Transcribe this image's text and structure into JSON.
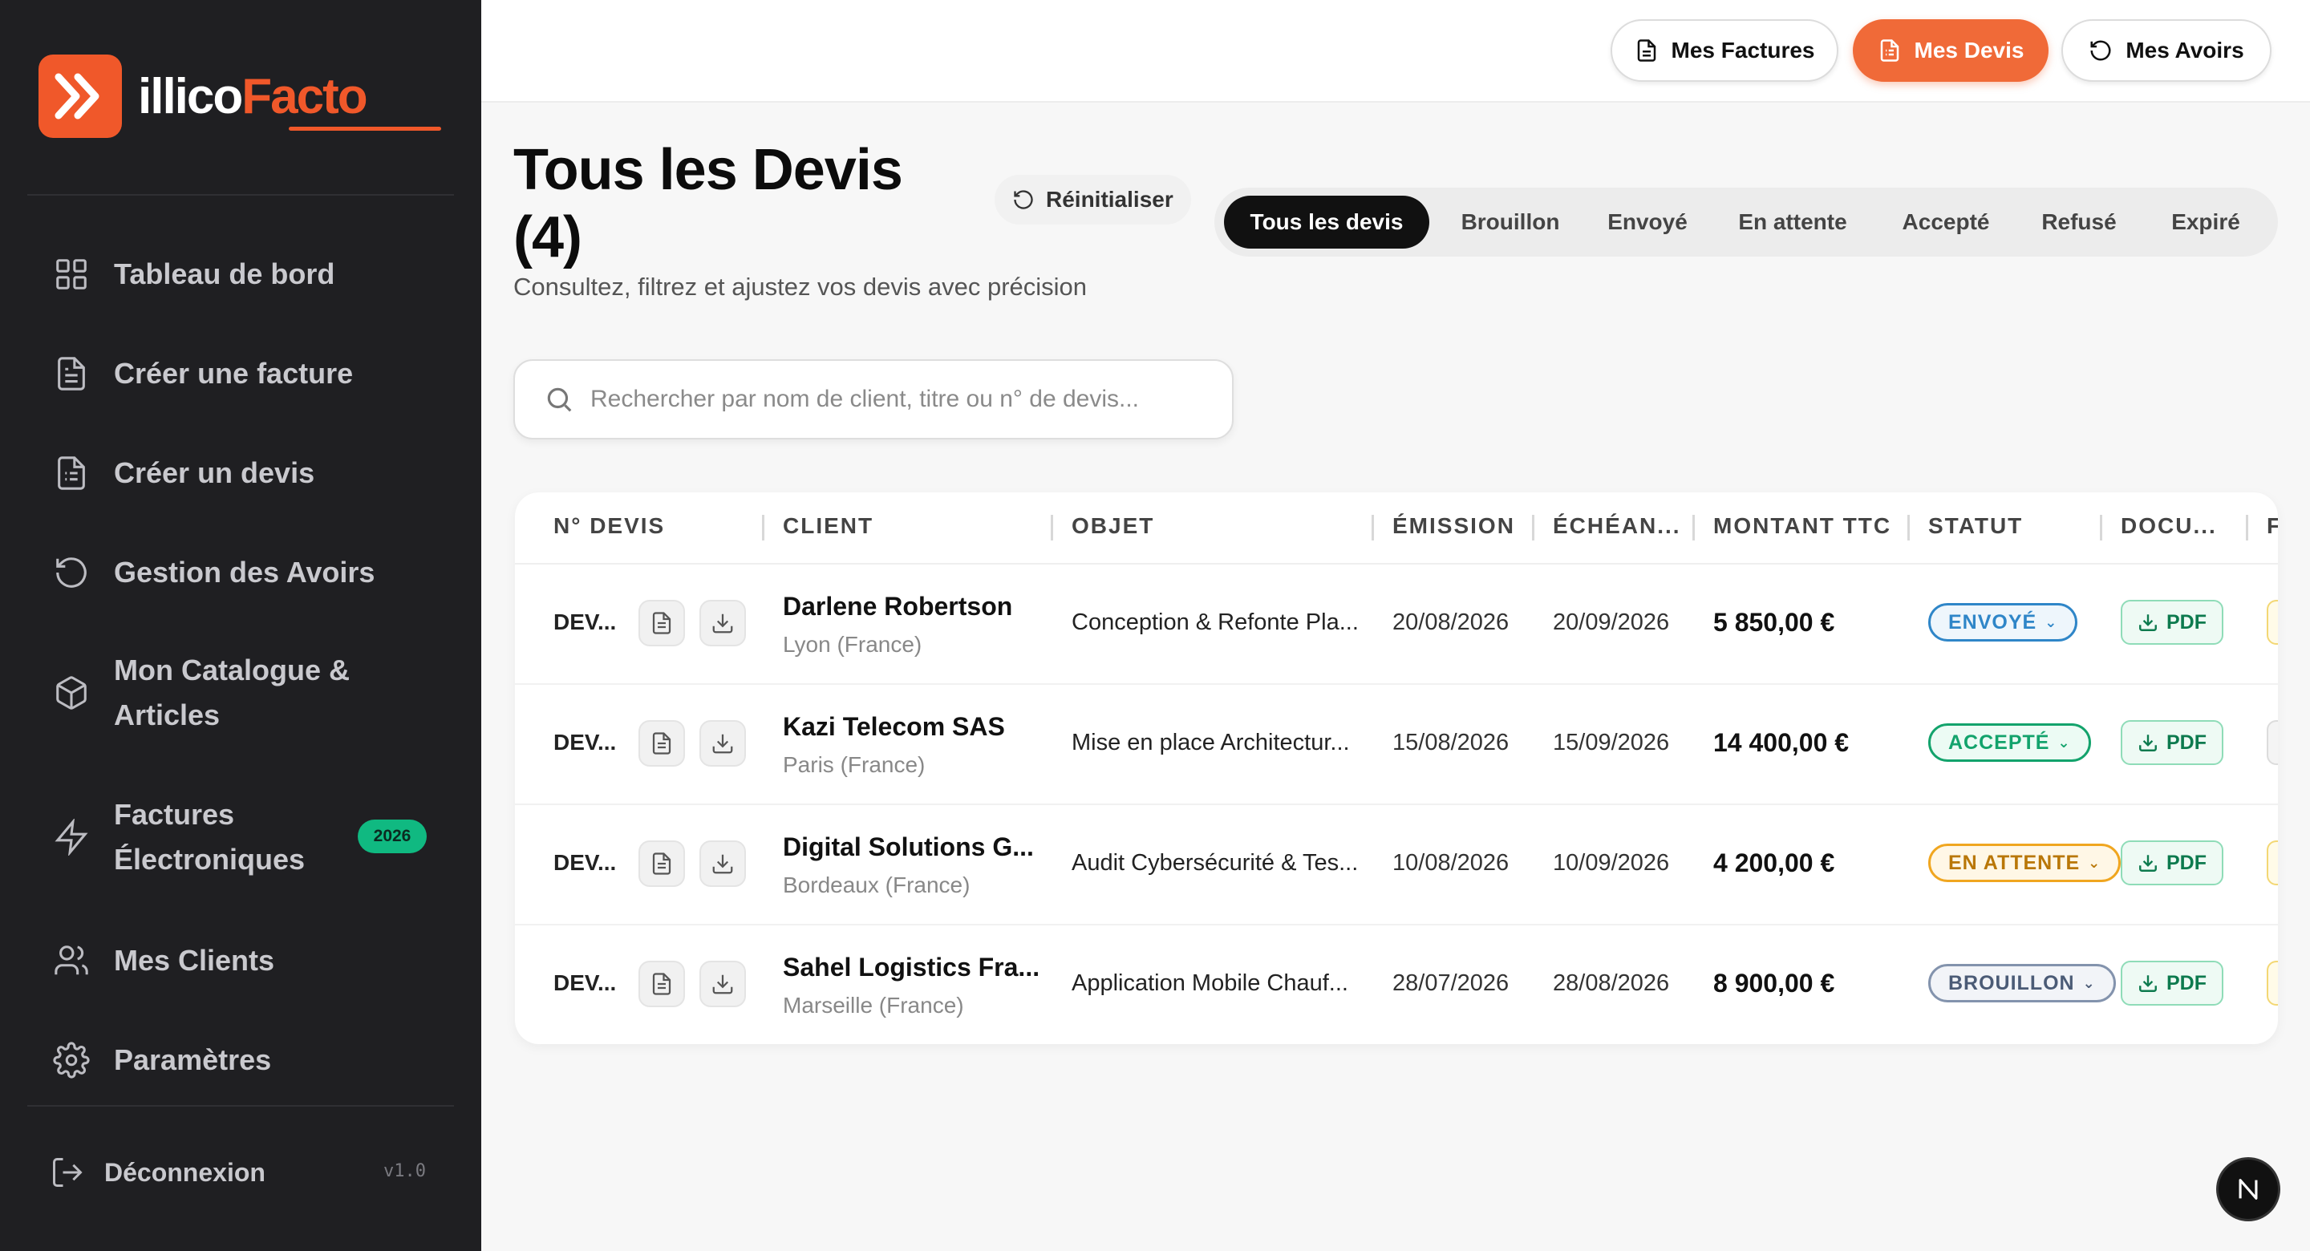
{
  "brand": {
    "part1": "illico",
    "part2": "Facto",
    "accent": "#f0582a"
  },
  "sidebar": {
    "items": [
      {
        "label": "Tableau de bord",
        "icon": "grid-icon"
      },
      {
        "label": "Créer une facture",
        "icon": "document-icon"
      },
      {
        "label": "Créer un devis",
        "icon": "document-list-icon"
      },
      {
        "label": "Gestion des Avoirs",
        "icon": "rotate-ccw-icon"
      },
      {
        "label_line1": "Mon Catalogue &",
        "label_line2": "Articles",
        "icon": "package-icon"
      },
      {
        "label_line1": "Factures",
        "label_line2": "Électroniques",
        "icon": "lightning-icon",
        "badge": "2026"
      },
      {
        "label": "Mes Clients",
        "icon": "users-icon"
      },
      {
        "label": "Paramètres",
        "icon": "gear-icon"
      }
    ],
    "logout": "Déconnexion",
    "version": "v1.0"
  },
  "topnav": {
    "factures": "Mes Factures",
    "devis": "Mes Devis",
    "avoirs": "Mes Avoirs",
    "active": "Mes Devis"
  },
  "header": {
    "title_line1": "Tous les Devis",
    "title_line2": "(4)",
    "subtitle": "Consultez, filtrez et ajustez vos devis avec précision",
    "reset": "Réinitialiser"
  },
  "filters": {
    "tabs": [
      "Tous les devis",
      "Brouillon",
      "Envoyé",
      "En attente",
      "Accepté",
      "Refusé",
      "Expiré"
    ],
    "active": "Tous les devis"
  },
  "search": {
    "placeholder": "Rechercher par nom de client, titre ou n° de devis..."
  },
  "table": {
    "columns": [
      "N° DEVIS",
      "CLIENT",
      "OBJET",
      "ÉMISSION",
      "ÉCHÉAN...",
      "MONTANT TTC",
      "STATUT",
      "DOCU...",
      "F"
    ],
    "rows": [
      {
        "num": "DEV...",
        "client": "Darlene Robertson",
        "location": "Lyon (France)",
        "objet": "Conception & Refonte Pla...",
        "emission": "20/08/2026",
        "echeance": "20/09/2026",
        "montant": "5 850,00 €",
        "statut": "ENVOYÉ",
        "doc": "PDF"
      },
      {
        "num": "DEV...",
        "client": "Kazi Telecom SAS",
        "location": "Paris (France)",
        "objet": "Mise en place Architectur...",
        "emission": "15/08/2026",
        "echeance": "15/09/2026",
        "montant": "14 400,00 €",
        "statut": "ACCEPTÉ",
        "doc": "PDF"
      },
      {
        "num": "DEV...",
        "client": "Digital Solutions G...",
        "location": "Bordeaux (France)",
        "objet": "Audit Cybersécurité & Tes...",
        "emission": "10/08/2026",
        "echeance": "10/09/2026",
        "montant": "4 200,00 €",
        "statut": "EN ATTENTE",
        "doc": "PDF"
      },
      {
        "num": "DEV...",
        "client": "Sahel Logistics Fra...",
        "location": "Marseille (France)",
        "objet": "Application Mobile Chauf...",
        "emission": "28/07/2026",
        "echeance": "28/08/2026",
        "montant": "8 900,00 €",
        "statut": "BROUILLON",
        "doc": "PDF"
      }
    ]
  },
  "status_colors": {
    "ENVOYÉ": "#2f86c8",
    "ACCEPTÉ": "#13a36c",
    "EN ATTENTE": "#e89a10",
    "BROUILLON": "#5c6f8c"
  },
  "corner_badge": "N"
}
